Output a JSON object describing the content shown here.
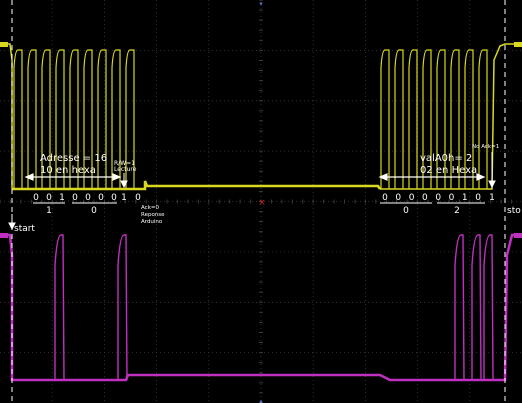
{
  "chart_data": {
    "type": "line",
    "title": "",
    "xlabel": "",
    "ylabel": "",
    "grid": true,
    "colors": {
      "background": "#000000",
      "grid": "#3a3a3a",
      "sda": "#d8d820",
      "scl": "#c030c0",
      "marker": "#ffffff",
      "trigger": "#d02020"
    },
    "series": [
      {
        "name": "",
        "channel": "SDA",
        "level_high": 1,
        "level_low": 0,
        "clock_pulses_first_burst": 9,
        "clock_pulses_second_burst": 8
      },
      {
        "name": "",
        "channel": "SCL",
        "level_high": 1,
        "level_low": 0,
        "pulses": [
          1,
          1,
          1,
          1,
          1
        ]
      }
    ],
    "annotations": {
      "address_title": "Adresse = 16",
      "address_hex": "10 en hexa",
      "rw_label": "R/W=1",
      "rw_sub": "Lecture",
      "ack_label": "Ack=0",
      "ack_sub1": "Reponse",
      "ack_sub2": "Arduino",
      "value_title": "valA0h= 2",
      "value_hex": "02 en Hexa",
      "nack_label": "No Ack=1",
      "start_label": "start",
      "stop_label": "sto"
    },
    "address_bits": [
      "0",
      "0",
      "1",
      "0",
      "0",
      "0",
      "0"
    ],
    "address_nibbles": [
      "1",
      "0"
    ],
    "rw_bit": "1",
    "ack_bit": "0",
    "value_bits": [
      "0",
      "0",
      "0",
      "0",
      "0",
      "0",
      "1",
      "0"
    ],
    "value_nibbles": [
      "0",
      "2"
    ],
    "nack_bit": "1"
  }
}
